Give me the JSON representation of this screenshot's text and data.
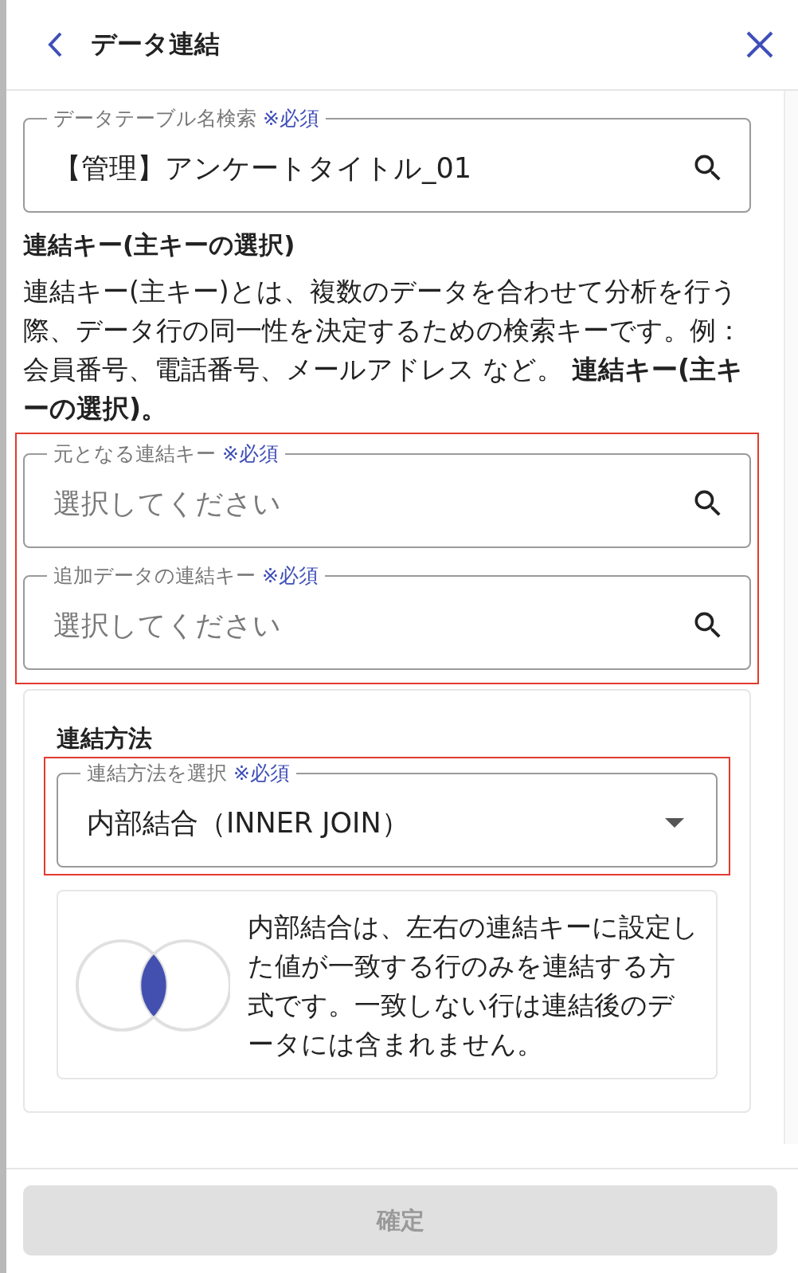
{
  "header": {
    "title": "データ連結"
  },
  "table_search": {
    "label": "データテーブル名検索",
    "required": "※必須",
    "value": "【管理】アンケートタイトル_01"
  },
  "key_section": {
    "heading": "連結キー(主キーの選択)",
    "description": "連結キー(主キー)とは、複数のデータを合わせて分析を行う際、データ行の同一性を決定するための検索キーです。例：会員番号、電話番号、メールアドレス など。 **連結キー(主キーの選択)。**"
  },
  "key_fields": {
    "highlighted": true,
    "fields": [
      {
        "label": "元となる連結キー",
        "required": "※必須",
        "placeholder": "選択してください"
      },
      {
        "label": "追加データの連結キー",
        "required": "※必須",
        "placeholder": "選択してください"
      }
    ]
  },
  "join_method": {
    "heading": "連結方法",
    "select": {
      "label": "連結方法を選択",
      "required": "※必須",
      "value": "内部結合（INNER JOIN）",
      "highlighted": true
    },
    "explanation": "内部結合は、左右の連結キーに設定した値が一致する行のみを連結する方式です。一致しない行は連結後のデータには含まれません。"
  },
  "confirm_button": {
    "label": "確定",
    "disabled": true
  }
}
